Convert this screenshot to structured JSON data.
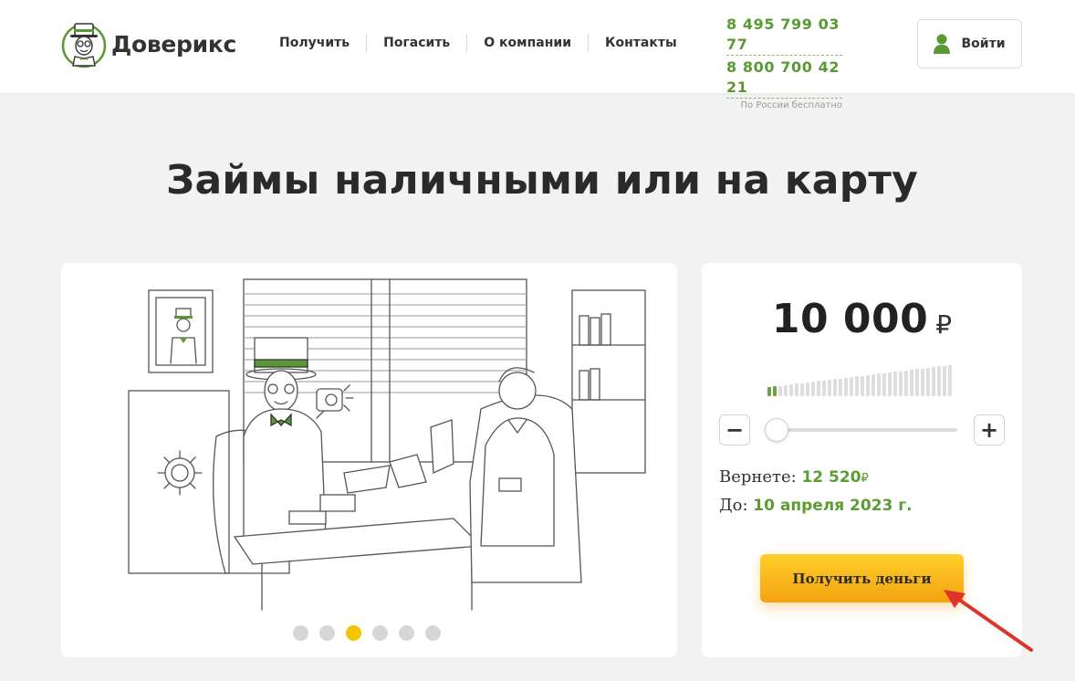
{
  "header": {
    "brand": "Доверикс",
    "nav": [
      "Получить",
      "Погасить",
      "О компании",
      "Контакты"
    ],
    "phones": [
      "8 495 799 03 77",
      "8 800 700 42 21"
    ],
    "phone_note": "По России бесплатно",
    "login_label": "Войти"
  },
  "main": {
    "title": "Займы наличными или на карту"
  },
  "carousel": {
    "slides": 6,
    "active_slide": 3
  },
  "calculator": {
    "amount": "10 000",
    "currency": "₽",
    "minus_label": "−",
    "plus_label": "+",
    "slider_fraction": 0.02,
    "return_label": "Вернете:",
    "return_value": "12 520",
    "return_currency": "₽",
    "until_label": "До:",
    "until_value": "10 апреля 2023 г.",
    "cta_label": "Получить деньги"
  },
  "colors": {
    "brand_green": "#5c9c33",
    "cta_yellow": "#f7b51a",
    "active_dot": "#f2c500",
    "annotation_red": "#e0332b"
  },
  "icons": [
    "logo-mascot-icon",
    "user-icon",
    "minus-icon",
    "plus-icon",
    "red-arrow-annotation"
  ]
}
